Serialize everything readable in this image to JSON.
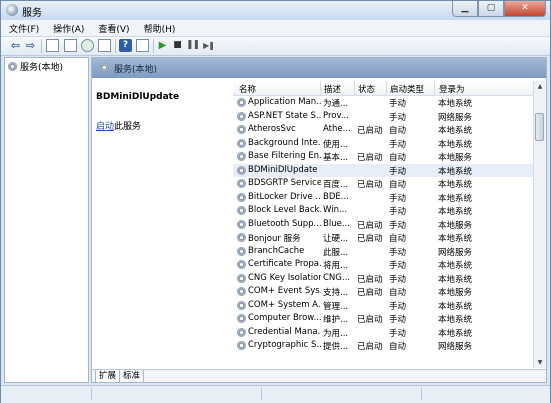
{
  "window": {
    "title": "服务",
    "min_glyph": "▁",
    "max_glyph": "▢",
    "close_glyph": "✕"
  },
  "menubar": [
    "文件(F)",
    "操作(A)",
    "查看(V)",
    "帮助(H)"
  ],
  "toolbar": {
    "back_glyph": "⇦",
    "forward_glyph": "⇨",
    "help_glyph": "?",
    "start_glyph": "▶",
    "stop_glyph": "■",
    "pause_glyph": "❚❚",
    "restart_glyph": "▶❚"
  },
  "tree": {
    "item": "服务(本地)"
  },
  "panel": {
    "header": "服务(本地)",
    "selected_name": "BDMiniDlUpdate",
    "start_link": "启动",
    "start_suffix": "此服务"
  },
  "list": {
    "columns": [
      "名称",
      "描述",
      "状态",
      "启动类型",
      "登录为"
    ],
    "sort_glyph": "^",
    "rows": [
      {
        "name": "Application Man...",
        "desc": "为通...",
        "status": "",
        "startup": "手动",
        "logon": "本地系统"
      },
      {
        "name": "ASP.NET State S...",
        "desc": "Prov...",
        "status": "",
        "startup": "手动",
        "logon": "网络服务"
      },
      {
        "name": "AtherosSvc",
        "desc": "Athe...",
        "status": "已启动",
        "startup": "自动",
        "logon": "本地系统"
      },
      {
        "name": "Background Inte...",
        "desc": "使用...",
        "status": "",
        "startup": "手动",
        "logon": "本地系统"
      },
      {
        "name": "Base Filtering En...",
        "desc": "基本...",
        "status": "已启动",
        "startup": "自动",
        "logon": "本地服务"
      },
      {
        "name": "BDMiniDlUpdate",
        "desc": "",
        "status": "",
        "startup": "手动",
        "logon": "本地系统"
      },
      {
        "name": "BDSGRTP Service",
        "desc": "百度...",
        "status": "已启动",
        "startup": "自动",
        "logon": "本地系统"
      },
      {
        "name": "BitLocker Drive ...",
        "desc": "BDE...",
        "status": "",
        "startup": "手动",
        "logon": "本地系统"
      },
      {
        "name": "Block Level Back...",
        "desc": "Win...",
        "status": "",
        "startup": "手动",
        "logon": "本地系统"
      },
      {
        "name": "Bluetooth Supp...",
        "desc": "Blue...",
        "status": "已启动",
        "startup": "手动",
        "logon": "本地服务"
      },
      {
        "name": "Bonjour 服务",
        "desc": "让硬...",
        "status": "已启动",
        "startup": "自动",
        "logon": "本地系统"
      },
      {
        "name": "BranchCache",
        "desc": "此服...",
        "status": "",
        "startup": "手动",
        "logon": "网络服务"
      },
      {
        "name": "Certificate Propa...",
        "desc": "将用...",
        "status": "",
        "startup": "手动",
        "logon": "本地系统"
      },
      {
        "name": "CNG Key Isolation",
        "desc": "CNG...",
        "status": "已启动",
        "startup": "手动",
        "logon": "本地系统"
      },
      {
        "name": "COM+ Event Sys...",
        "desc": "支持...",
        "status": "已启动",
        "startup": "自动",
        "logon": "本地服务"
      },
      {
        "name": "COM+ System A...",
        "desc": "管理...",
        "status": "",
        "startup": "手动",
        "logon": "本地系统"
      },
      {
        "name": "Computer Brow...",
        "desc": "维护...",
        "status": "已启动",
        "startup": "手动",
        "logon": "本地系统"
      },
      {
        "name": "Credential Mana...",
        "desc": "为用...",
        "status": "",
        "startup": "手动",
        "logon": "本地系统"
      },
      {
        "name": "Cryptographic S...",
        "desc": "提供...",
        "status": "已启动",
        "startup": "自动",
        "logon": "网络服务"
      }
    ],
    "selected_index": 5
  },
  "tabs": [
    "扩展",
    "标准"
  ]
}
